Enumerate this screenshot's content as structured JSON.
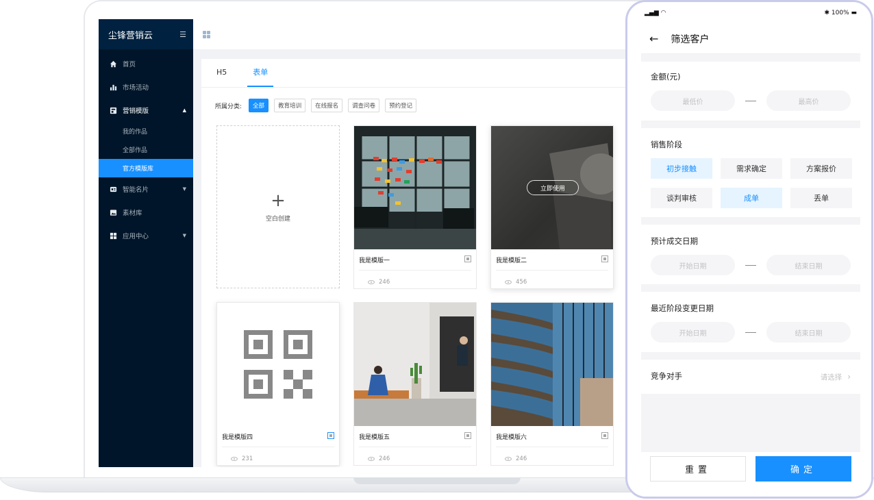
{
  "app": {
    "brand": "尘锋营销云"
  },
  "sidebar": {
    "items": [
      {
        "label": "首页"
      },
      {
        "label": "市场活动"
      },
      {
        "label": "营销模版",
        "children": [
          "我的作品",
          "全部作品",
          "官方模版库"
        ]
      },
      {
        "label": "智能名片"
      },
      {
        "label": "素材库"
      },
      {
        "label": "应用中心"
      }
    ],
    "active_sub": "官方模版库"
  },
  "tabs": [
    {
      "label": "H5"
    },
    {
      "label": "表单"
    }
  ],
  "active_tab": "表单",
  "filter": {
    "label": "所属分类:",
    "chips": [
      {
        "label": "全部"
      },
      {
        "label": "教育培训"
      },
      {
        "label": "在线报名"
      },
      {
        "label": "调查问卷"
      },
      {
        "label": "预约登记"
      }
    ],
    "active": "全部"
  },
  "create_card": {
    "label": "空白创建",
    "icon": "plus-icon"
  },
  "hover_button": "立即使用",
  "templates": [
    {
      "title": "我是模版一",
      "views": "246"
    },
    {
      "title": "我是模版二",
      "views": "456"
    },
    {
      "title": "我是模版四",
      "views": "231"
    },
    {
      "title": "我是模版五",
      "views": "246"
    },
    {
      "title": "我是模版六",
      "views": "246"
    }
  ],
  "phone": {
    "status": {
      "battery": "100%"
    },
    "title": "筛选客户",
    "amount": {
      "title": "金额(元)",
      "min": "最低价",
      "max": "最高价"
    },
    "stage": {
      "title": "销售阶段",
      "options": [
        "初步接触",
        "需求确定",
        "方案报价",
        "谈判审核",
        "成单",
        "丢单"
      ],
      "selected": [
        "初步接触",
        "成单"
      ]
    },
    "deal_date": {
      "title": "预计成交日期",
      "start": "开始日期",
      "end": "结束日期"
    },
    "stage_change_date": {
      "title": "最近阶段变更日期",
      "start": "开始日期",
      "end": "结束日期"
    },
    "competitor": {
      "title": "竞争对手",
      "placeholder": "请选择"
    },
    "reset": "重置",
    "confirm": "确定"
  },
  "colors": {
    "primary": "#1890ff",
    "sidebar": "#001529",
    "phone_frame": "#c9cbeb"
  }
}
